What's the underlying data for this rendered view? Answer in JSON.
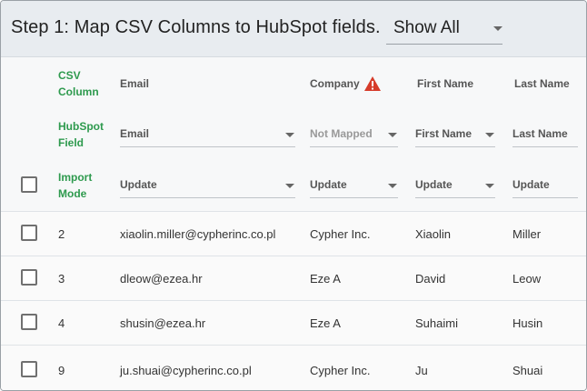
{
  "header": {
    "title": "Step 1: Map CSV Columns to HubSpot fields.",
    "filter_value": "Show All"
  },
  "colors": {
    "accent_green": "#2e9a4e",
    "warning_red": "#d63b2a"
  },
  "row_labels": {
    "csv_column_1": "CSV",
    "csv_column_2": "Column",
    "hubspot_field_1": "HubSpot",
    "hubspot_field_2": "Field",
    "import_mode_1": "Import",
    "import_mode_2": "Mode"
  },
  "columns": [
    {
      "csv": "Email",
      "field": "Email",
      "mode": "Update"
    },
    {
      "csv": "Company",
      "field": "Not Mapped",
      "mode": "Update",
      "warning": true
    },
    {
      "csv": "First Name",
      "field": "First Name",
      "mode": "Update"
    },
    {
      "csv": "Last Name",
      "field": "Last Name",
      "mode": "Update"
    }
  ],
  "rows": [
    {
      "num": "2",
      "email": "xiaolin.miller@cypherinc.co.pl",
      "company": "Cypher Inc.",
      "first": "Xiaolin",
      "last": "Miller"
    },
    {
      "num": "3",
      "email": "dleow@ezea.hr",
      "company": "Eze A",
      "first": "David",
      "last": "Leow"
    },
    {
      "num": "4",
      "email": "shusin@ezea.hr",
      "company": "Eze A",
      "first": "Suhaimi",
      "last": "Husin"
    },
    {
      "num": "9",
      "email": "ju.shuai@cypherinc.co.pl",
      "company": "Cypher Inc.",
      "first": "Ju",
      "last": "Shuai"
    }
  ]
}
